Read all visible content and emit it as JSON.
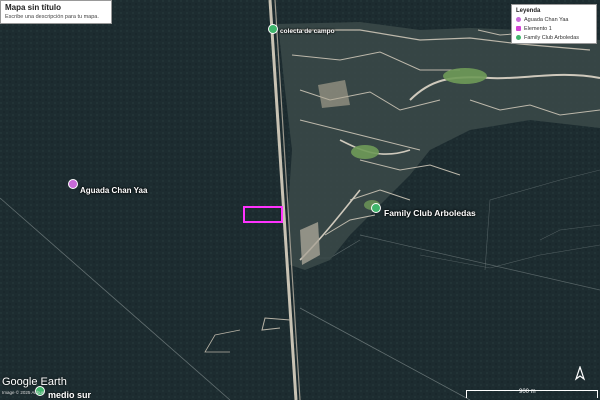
{
  "title_panel": {
    "title": "Mapa sin título",
    "description": "Escribe una descripción para tu mapa."
  },
  "legend": {
    "heading": "Leyenda",
    "items": [
      {
        "label": "Aguada Chan Yaa",
        "color": "#c86ad9",
        "icon": "purple-pin-icon"
      },
      {
        "label": "Elemento 1",
        "color": "#d444d4",
        "icon": "magenta-polygon-icon"
      },
      {
        "label": "Family Club Arboledas",
        "color": "#3fb56b",
        "icon": "green-pin-icon"
      }
    ]
  },
  "places": {
    "aguada": {
      "label": "Aguada Chan Yaa",
      "color": "#c86ad9"
    },
    "colecta": {
      "label": "colecta de campo",
      "color": "#3fb56b"
    },
    "family_club": {
      "label": "Family Club Arboledas",
      "color": "#3fb56b"
    },
    "bottom": {
      "label": "medio sur",
      "color": "#3fb56b"
    }
  },
  "branding": {
    "logo": "Google Earth",
    "copyright": "Image © 2025 Airbus"
  },
  "scale": {
    "label": "900 m"
  },
  "compass": {
    "label": "N"
  },
  "colors": {
    "forest": "#1b2a2e",
    "road": "#c9c3b4",
    "polygon": "#ff33ff"
  }
}
